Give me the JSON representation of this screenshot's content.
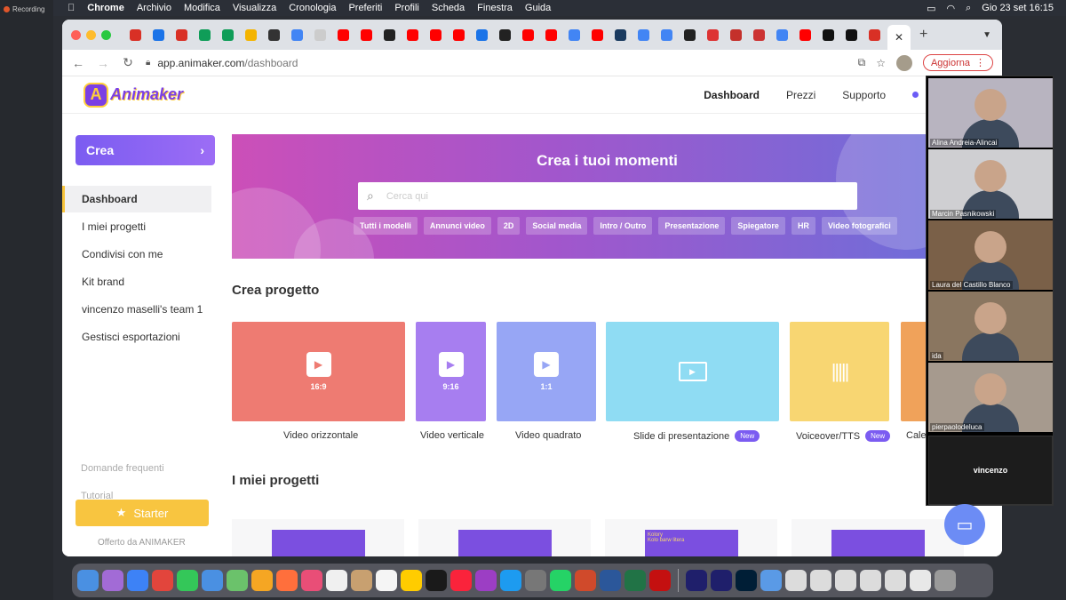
{
  "recording": {
    "label": "Recording"
  },
  "menubar": {
    "app": "Chrome",
    "items": [
      "Archivio",
      "Modifica",
      "Visualizza",
      "Cronologia",
      "Preferiti",
      "Profili",
      "Scheda",
      "Finestra",
      "Guida"
    ],
    "datetime": "Gio 23 set  16:15"
  },
  "browser": {
    "url_host": "app.animaker.com",
    "url_path": "/dashboard",
    "update_label": "Aggiorna",
    "active_tab_close": "✕",
    "new_tab": "+",
    "tab_favicon_colors": [
      "#d93025",
      "#1a73e8",
      "#d93025",
      "#0f9d58",
      "#0f9d58",
      "#f4b400",
      "#333333",
      "#4285f4",
      "#cccccc",
      "#ff0000",
      "#ff0000",
      "#222222",
      "#ff0000",
      "#ff0000",
      "#ff0000",
      "#1a73e8",
      "#222222",
      "#ff0000",
      "#ff0000",
      "#4285f4",
      "#ff0000",
      "#1a3a5f",
      "#4285f4",
      "#4285f4",
      "#222222",
      "#dd3333",
      "#c4302b",
      "#cc3333",
      "#4285f4",
      "#ff0000",
      "#111111",
      "#111111",
      "#d93025"
    ]
  },
  "app": {
    "logo_text": "Animaker",
    "nav": {
      "dashboard": "Dashboard",
      "pricing": "Prezzi",
      "support": "Supporto"
    },
    "sidebar": {
      "create": "Crea",
      "items": [
        "Dashboard",
        "I miei progetti",
        "Condivisi con me",
        "Kit brand",
        "vincenzo maselli's team 1",
        "Gestisci esportazioni"
      ],
      "faq": "Domande frequenti",
      "tutorial": "Tutorial",
      "starter": "Starter",
      "offered": "Offerto da ANIMAKER"
    },
    "hero": {
      "title": "Crea i tuoi momenti",
      "search_placeholder": "Cerca qui",
      "chips": [
        "Tutti i modelli",
        "Annunci video",
        "2D",
        "Social media",
        "Intro / Outro",
        "Presentazione",
        "Spiegatore",
        "HR",
        "Video fotografici"
      ]
    },
    "create_project": {
      "title": "Crea progetto",
      "cards": [
        {
          "label": "Video orizzontale",
          "ratio": "16:9",
          "color": "#ee7b72",
          "new": false
        },
        {
          "label": "Video verticale",
          "ratio": "9:16",
          "color": "#a77ef0",
          "new": false
        },
        {
          "label": "Video quadrato",
          "ratio": "1:1",
          "color": "#97a6f5",
          "new": false
        },
        {
          "label": "Slide di presentazione",
          "ratio": "",
          "color": "#8fdcf3",
          "new": true
        },
        {
          "label": "Voiceover/TTS",
          "ratio": "",
          "color": "#f8d672",
          "new": true
        },
        {
          "label": "Cale",
          "ratio": "",
          "color": "#f0a25a",
          "new": false
        }
      ],
      "new_badge": "New"
    },
    "my_projects": {
      "title": "I miei progetti",
      "thumb_text": "Kolory\nKolo barw litera"
    }
  },
  "zoom": {
    "participants": [
      "Alina Andreia-Alincai",
      "Marcin Pasnikowski",
      "Laura del Castillo Blanco",
      "ida",
      "pierpaolodeluca"
    ],
    "self": "vincenzo"
  },
  "dock": {
    "colors": [
      "#4a90e2",
      "#a26bd6",
      "#3d82f6",
      "#e2453c",
      "#34c759",
      "#4a90e2",
      "#6bc26b",
      "#f5a623",
      "#ff6f3c",
      "#e94e77",
      "#f0f0f0",
      "#c8a070",
      "#f5f5f5",
      "#ffcc00",
      "#1a1a1a",
      "#fa233b",
      "#9c3ec4",
      "#1d9bf0",
      "#777777",
      "#25d366",
      "#d04a2b",
      "#2b579a",
      "#217346",
      "#c41010",
      "#1f1f6b",
      "#1f1f6b",
      "#001e36"
    ]
  }
}
